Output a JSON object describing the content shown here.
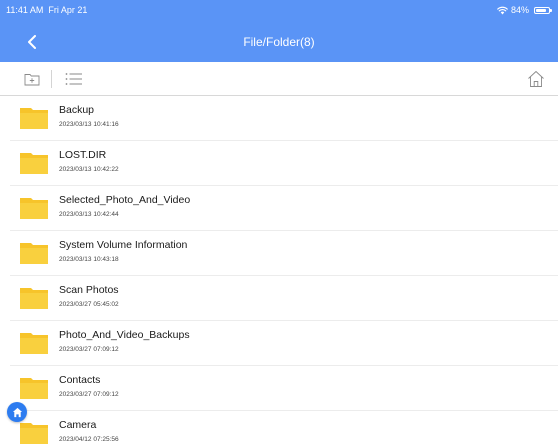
{
  "status_bar": {
    "time": "11:41 AM",
    "date": "Fri Apr 21",
    "battery_text": "84%"
  },
  "nav": {
    "title": "File/Folder(8)",
    "back_icon": "chevron-left-icon"
  },
  "toolbar": {
    "new_folder_icon": "add-folder-icon",
    "list_view_icon": "list-view-icon",
    "home_icon": "home-icon"
  },
  "colors": {
    "header_blue": "#5a94f6",
    "folder_yellow": "#f7c42a",
    "floating_button": "#2d7cf0"
  },
  "files": [
    {
      "name": "Backup",
      "date": "2023/03/13 10:41:16"
    },
    {
      "name": "LOST.DIR",
      "date": "2023/03/13 10:42:22"
    },
    {
      "name": "Selected_Photo_And_Video",
      "date": "2023/03/13 10:42:44"
    },
    {
      "name": "System Volume Information",
      "date": "2023/03/13 10:43:18"
    },
    {
      "name": "Scan Photos",
      "date": "2023/03/27 05:45:02"
    },
    {
      "name": "Photo_And_Video_Backups",
      "date": "2023/03/27 07:09:12"
    },
    {
      "name": "Contacts",
      "date": "2023/03/27 07:09:12"
    },
    {
      "name": "Camera",
      "date": "2023/04/12 07:25:56"
    }
  ]
}
